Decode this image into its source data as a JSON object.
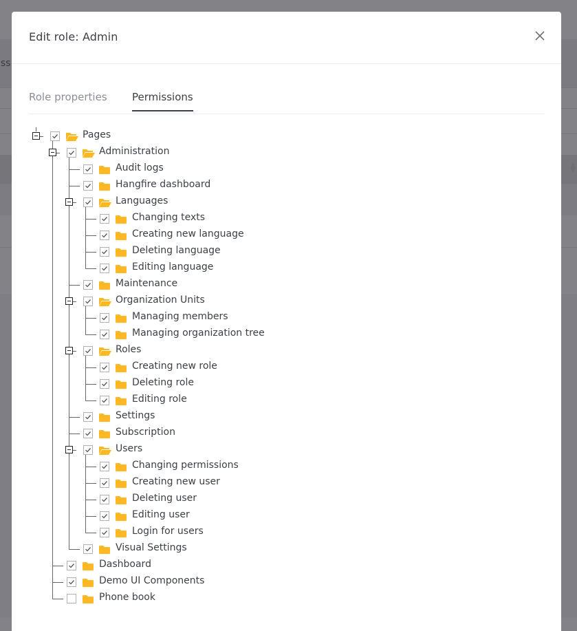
{
  "background": {
    "partial_text": "iss"
  },
  "modal": {
    "title": "Edit role: Admin",
    "close_icon": "close-icon",
    "tabs": [
      {
        "label": "Role properties",
        "active": false
      },
      {
        "label": "Permissions",
        "active": true
      }
    ]
  },
  "colors": {
    "folder": "#ffb822",
    "text": "#3f4047",
    "tab_inactive": "#8d8e98",
    "checkbox_border": "#b3b3b3",
    "checkmark": "#5f5f5f"
  },
  "tree": [
    {
      "label": "Pages",
      "checked": true,
      "expanded": true,
      "children": [
        {
          "label": "Administration",
          "checked": true,
          "expanded": true,
          "children": [
            {
              "label": "Audit logs",
              "checked": true
            },
            {
              "label": "Hangfire dashboard",
              "checked": true
            },
            {
              "label": "Languages",
              "checked": true,
              "expanded": true,
              "children": [
                {
                  "label": "Changing texts",
                  "checked": true
                },
                {
                  "label": "Creating new language",
                  "checked": true
                },
                {
                  "label": "Deleting language",
                  "checked": true
                },
                {
                  "label": "Editing language",
                  "checked": true
                }
              ]
            },
            {
              "label": "Maintenance",
              "checked": true
            },
            {
              "label": "Organization Units",
              "checked": true,
              "expanded": true,
              "children": [
                {
                  "label": "Managing members",
                  "checked": true
                },
                {
                  "label": "Managing organization tree",
                  "checked": true
                }
              ]
            },
            {
              "label": "Roles",
              "checked": true,
              "expanded": true,
              "children": [
                {
                  "label": "Creating new role",
                  "checked": true
                },
                {
                  "label": "Deleting role",
                  "checked": true
                },
                {
                  "label": "Editing role",
                  "checked": true
                }
              ]
            },
            {
              "label": "Settings",
              "checked": true
            },
            {
              "label": "Subscription",
              "checked": true
            },
            {
              "label": "Users",
              "checked": true,
              "expanded": true,
              "children": [
                {
                  "label": "Changing permissions",
                  "checked": true
                },
                {
                  "label": "Creating new user",
                  "checked": true
                },
                {
                  "label": "Deleting user",
                  "checked": true
                },
                {
                  "label": "Editing user",
                  "checked": true
                },
                {
                  "label": "Login for users",
                  "checked": true
                }
              ]
            },
            {
              "label": "Visual Settings",
              "checked": true
            }
          ]
        },
        {
          "label": "Dashboard",
          "checked": true
        },
        {
          "label": "Demo UI Components",
          "checked": true
        },
        {
          "label": "Phone book",
          "checked": false
        }
      ]
    }
  ]
}
